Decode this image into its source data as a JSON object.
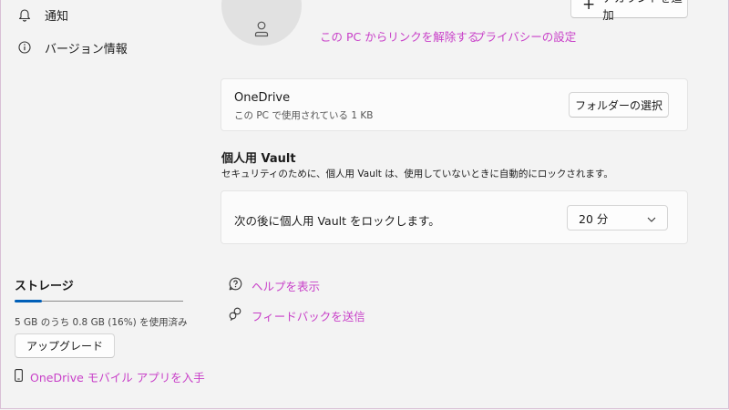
{
  "sidebar": {
    "items": [
      {
        "label": "通知",
        "icon": "bell-icon"
      },
      {
        "label": "バージョン情報",
        "icon": "info-icon"
      }
    ],
    "storage": {
      "title": "ストレージ",
      "usage_text": "5 GB のうち 0.8 GB (16%) を使用済み",
      "usage_fraction": 0.16,
      "upgrade_label": "アップグレード",
      "mobile_link": "OneDrive モバイル アプリを入手"
    }
  },
  "account": {
    "add_account_label": "アカウントを追加",
    "unlink_label": "この PC からリンクを解除する",
    "privacy_label": "プライバシーの設定"
  },
  "onedrive_card": {
    "title": "OneDrive",
    "subtitle": "この PC で使用されている 1 KB",
    "choose_folder_label": "フォルダーの選択"
  },
  "vault": {
    "title": "個人用 Vault",
    "description": "セキュリティのために、個人用 Vault は、使用していないときに自動的にロックされます。",
    "lock_label": "次の後に個人用 Vault をロックします。",
    "lock_value": "20 分"
  },
  "help": {
    "show_help": "ヘルプを表示",
    "send_feedback": "フィードバックを送信"
  },
  "colors": {
    "link": "#c83fc8",
    "accent": "#005fb8"
  }
}
